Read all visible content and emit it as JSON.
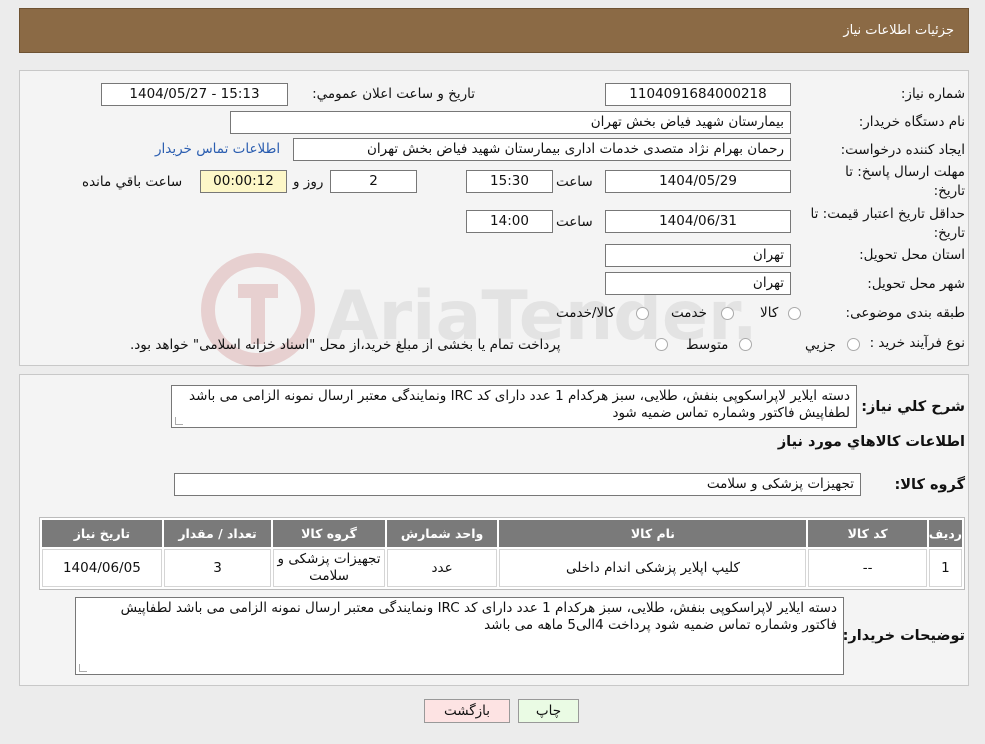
{
  "header": {
    "title": "جزئیات اطلاعات نیاز"
  },
  "fields": {
    "need_number_label": "شماره نیاز:",
    "need_number": "1104091684000218",
    "announce_label": "تاریخ و ساعت اعلان عمومي:",
    "announce_value": "1404/05/27 - 15:13",
    "buyer_org_label": "نام دستگاه خريدار:",
    "buyer_org": "بيمارستان شهيد فياض بخش تهران",
    "creator_label": "ايجاد كننده درخواست:",
    "creator": "رحمان بهرام نژاد متصدی خدمات اداری بيمارستان شهيد فياض بخش تهران",
    "contact_link": "اطلاعات تماس خريدار",
    "deadline_label_1": "مهلت ارسال پاسخ: تا",
    "deadline_label_2": "تاریخ:",
    "deadline_date": "1404/05/29",
    "time_label": "ساعت",
    "deadline_time": "15:30",
    "days_value": "2",
    "days_label": "روز و",
    "remaining_time": "00:00:12",
    "remaining_label": "ساعت باقي مانده",
    "validity_label_1": "حداقل تاريخ اعتبار قيمت: تا",
    "validity_label_2": "تاريخ:",
    "validity_date": "1404/06/31",
    "validity_time": "14:00",
    "province_label": "استان محل تحويل:",
    "province": "تهران",
    "city_label": "شهر محل تحويل:",
    "city": "تهران",
    "category_label": "طبقه بندی موضوعی:",
    "category_options": [
      "كالا",
      "خدمت",
      "كالا/خدمت"
    ],
    "process_label": "نوع فرآيند خريد :",
    "process_options": [
      "جزيي",
      "متوسط"
    ],
    "process_note": "پرداخت تمام يا بخشی از مبلغ خريد،از محل \"اسناد خزانه اسلامی\" خواهد بود."
  },
  "summary": {
    "label": "شرح كلي نياز:",
    "text": "دسته ایلایر لاپراسکوپی بنفش، طلایی، سبز هرکدام  1 عدد دارای کد IRC ونمایندگی معتبر ارسال نمونه الزامی می باشد لطفاپیش فاکتور وشماره تماس ضمیه شود"
  },
  "goods": {
    "section_title": "اطلاعات كالاهاي مورد نياز",
    "group_label": "گروه كالا:",
    "group_value": "تجهیزات پزشکی و سلامت",
    "columns": [
      "رديف",
      "كد كالا",
      "نام كالا",
      "واحد شمارش",
      "گروه كالا",
      "تعداد / مقدار",
      "تاريخ نياز"
    ],
    "rows": [
      {
        "index": "1",
        "code": "--",
        "name": "کلیپ اپلایر پزشکی اندام داخلی",
        "unit": "عدد",
        "group": "تجهيزات پزشكی و سلامت",
        "qty": "3",
        "date": "1404/06/05"
      }
    ]
  },
  "buyer_notes": {
    "label": "توضيحات خريدار:",
    "text": "دسته ایلایر لاپراسکوپی بنفش، طلایی، سبز هرکدام  1 عدد دارای کد IRC ونمایندگی معتبر ارسال نمونه الزامی می باشد لطفاپیش فاکتور وشماره تماس ضمیه شود پرداخت 4الی5 ماهه می باشد"
  },
  "buttons": {
    "print": "چاپ",
    "back": "بازگشت"
  },
  "watermark_text": "AriaTender.neT"
}
